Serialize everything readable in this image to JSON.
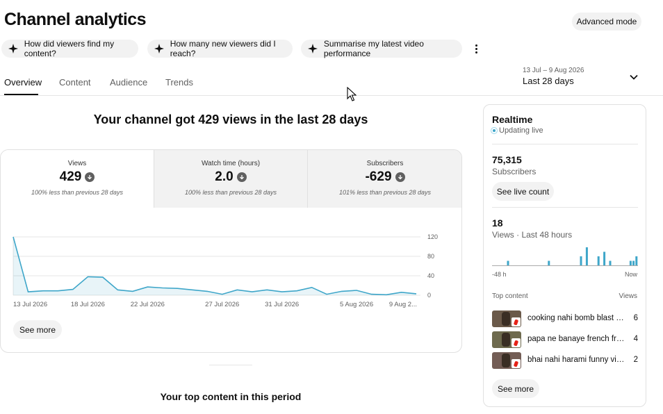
{
  "header": {
    "title": "Channel analytics",
    "advanced_mode_label": "Advanced mode"
  },
  "chips": [
    {
      "label": "How did viewers find my content?",
      "icon": "sparkle-icon"
    },
    {
      "label": "How many new viewers did I reach?",
      "icon": "sparkle-icon"
    },
    {
      "label": "Summarise my latest video performance",
      "icon": "sparkle-icon"
    }
  ],
  "tabs": [
    {
      "label": "Overview",
      "active": true
    },
    {
      "label": "Content",
      "active": false
    },
    {
      "label": "Audience",
      "active": false
    },
    {
      "label": "Trends",
      "active": false
    }
  ],
  "date_range": {
    "range": "13 Jul – 9 Aug 2026",
    "label": "Last 28 days"
  },
  "summary": {
    "headline": "Your channel got 429 views in the last 28 days"
  },
  "metrics": [
    {
      "label": "Views",
      "value": "429",
      "note": "100% less than previous 28 days",
      "active": true
    },
    {
      "label": "Watch time (hours)",
      "value": "2.0",
      "note": "100% less than previous 28 days",
      "active": false
    },
    {
      "label": "Subscribers",
      "value": "-629",
      "note": "101% less than previous 28 days",
      "active": false
    }
  ],
  "main_chart": {
    "see_more_label": "See more"
  },
  "chart_data": {
    "type": "area",
    "title": "",
    "xlabel": "",
    "ylabel": "",
    "ylim": [
      0,
      120
    ],
    "yticks": [
      "120",
      "80",
      "40",
      "0"
    ],
    "xtick_labels": [
      "13 Jul 2026",
      "18 Jul 2026",
      "22 Jul 2026",
      "27 Jul 2026",
      "31 Jul 2026",
      "5 Aug 2026",
      "9 Aug 2..."
    ],
    "x": [
      "13 Jul",
      "14 Jul",
      "15 Jul",
      "16 Jul",
      "17 Jul",
      "18 Jul",
      "19 Jul",
      "20 Jul",
      "21 Jul",
      "22 Jul",
      "23 Jul",
      "24 Jul",
      "25 Jul",
      "26 Jul",
      "27 Jul",
      "28 Jul",
      "29 Jul",
      "30 Jul",
      "31 Jul",
      "1 Aug",
      "2 Aug",
      "3 Aug",
      "4 Aug",
      "5 Aug",
      "6 Aug",
      "7 Aug",
      "8 Aug",
      "9 Aug"
    ],
    "series": [
      {
        "values": [
          120,
          7,
          9,
          9,
          12,
          38,
          37,
          11,
          8,
          17,
          15,
          14,
          11,
          8,
          2,
          11,
          7,
          11,
          7,
          9,
          16,
          2,
          8,
          10,
          2,
          1,
          6,
          3
        ]
      }
    ],
    "grid": true,
    "color": "#3ea6c9"
  },
  "realtime": {
    "title": "Realtime",
    "status": "Updating live",
    "subscribers_value": "75,315",
    "subscribers_label": "Subscribers",
    "see_live_count_label": "See live count",
    "views_value": "18",
    "views_label": "Views · Last 48 hours",
    "axis_start": "-48 h",
    "axis_end": "Now",
    "top_content_label": "Top content",
    "views_col_label": "Views",
    "see_more_label": "See more",
    "bars": [
      0,
      0,
      0,
      0,
      0,
      1,
      0,
      0,
      0,
      0,
      0,
      0,
      0,
      0,
      0,
      0,
      0,
      0,
      0,
      1,
      0,
      0,
      0,
      0,
      0,
      0,
      0,
      0,
      0,
      0,
      2,
      0,
      4,
      0,
      0,
      0,
      2,
      0,
      3,
      0,
      1,
      0,
      0,
      0,
      0,
      0,
      0,
      1,
      1,
      2
    ],
    "items": [
      {
        "title": "cooking nahi bomb blast fu...",
        "views": "6"
      },
      {
        "title": "papa ne banaye french frie...",
        "views": "4"
      },
      {
        "title": "bhai nahi harami funny vid...",
        "views": "2"
      }
    ]
  },
  "top_content": {
    "title": "Your top content in this period"
  }
}
